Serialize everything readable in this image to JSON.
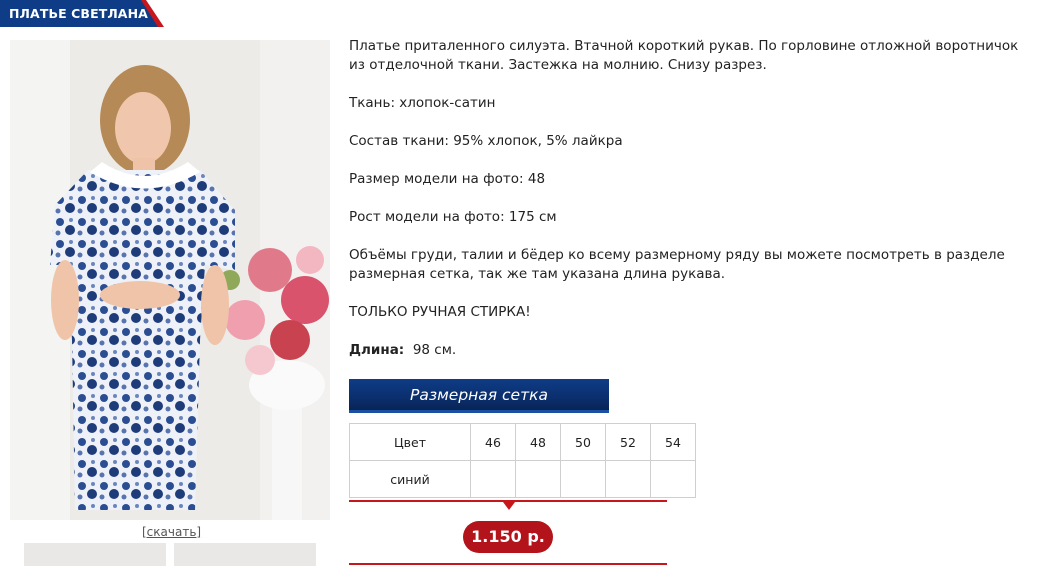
{
  "product": {
    "title": "ПЛАТЬЕ СВЕТЛАНА",
    "download_label": "[скачать]",
    "description": {
      "main": "Платье приталенного силуэта. Втачной короткий рукав. По горловине отложной воротничок из отделочной ткани. Застежка на молнию. Снизу разрез.",
      "fabric": "Ткань: хлопок-сатин",
      "composition": "Состав ткани: 95% хлопок, 5% лайкра",
      "model_size": "Размер модели на фото: 48",
      "model_height": "Рост модели на фото: 175 см",
      "measurements": "Объёмы груди, талии и бёдер ко всему размерному ряду вы можете посмотреть в разделе размерная сетка, так же там указана длина рукава.",
      "care": "ТОЛЬКО РУЧНАЯ СТИРКА!",
      "length_label": "Длина:",
      "length_value": "98 см."
    },
    "size_chart_button": "Размерная сетка",
    "size_table": {
      "color_header": "Цвет",
      "sizes": [
        "46",
        "48",
        "50",
        "52",
        "54"
      ],
      "rows": [
        {
          "color": "синий",
          "cells": [
            "",
            "",
            "",
            "",
            ""
          ]
        }
      ]
    },
    "price": "1.150 р."
  },
  "colors": {
    "accent_blue": "#0e3c86",
    "accent_red": "#c8161d",
    "price_pill": "#b3131a"
  }
}
